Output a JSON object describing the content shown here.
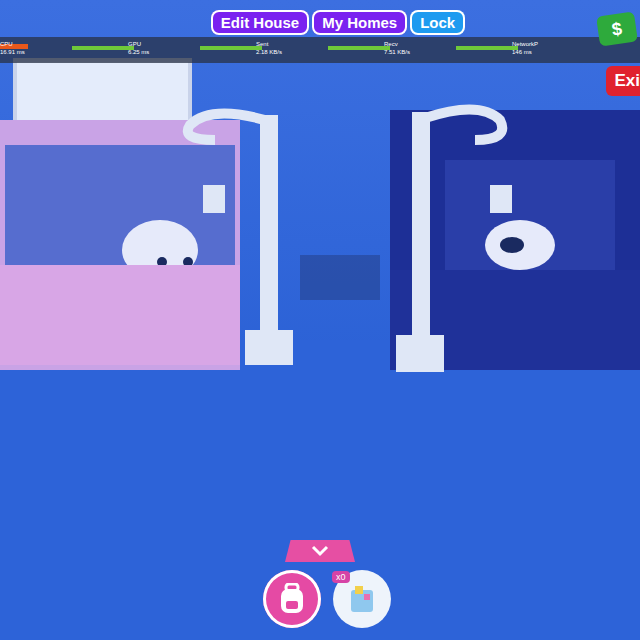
{
  "top_buttons": [
    {
      "label": "Edit House",
      "color": "#7a22f0"
    },
    {
      "label": "My Homes",
      "color": "#7a22f0"
    },
    {
      "label": "Lock",
      "color": "#1e9bf0"
    }
  ],
  "stats": [
    {
      "label": "CPU",
      "value": "16.91 ms"
    },
    {
      "label": "GPU",
      "value": "6.25 ms"
    },
    {
      "label": "Sent",
      "value": "2.18 KB/s"
    },
    {
      "label": "Recv",
      "value": "7.51 KB/s"
    },
    {
      "label": "NetworkP",
      "value": "146 ms"
    }
  ],
  "money_icon": {
    "symbol": "$"
  },
  "exit_button": {
    "label": "Exi"
  },
  "toy_button": {
    "badge": "x0"
  }
}
